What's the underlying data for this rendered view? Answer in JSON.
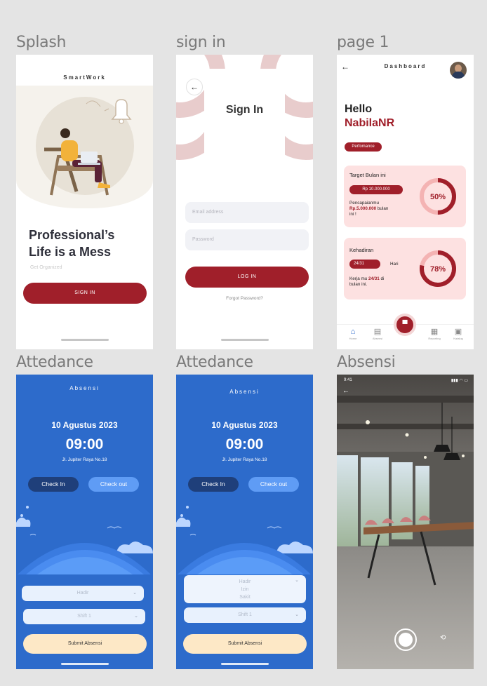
{
  "labels": {
    "splash": "Splash",
    "signin": "sign in",
    "page1": "page 1",
    "attendance1": "Attedance",
    "attendance2": "Attedance",
    "absensi": "Absensi"
  },
  "splash": {
    "brand": "SmartWork",
    "headline_1": "Professional’s",
    "headline_2": "Life is a Mess",
    "subtitle": "Get Organized",
    "button": "SIGN IN"
  },
  "signin": {
    "title": "Sign In",
    "email_placeholder": "Email address",
    "password_placeholder": "Password",
    "button": "LOG IN",
    "forgot": "Forgot Password?"
  },
  "dashboard": {
    "title": "Dashboard",
    "hello": "Hello",
    "name": "NabilaNR",
    "tag": "Perfomance",
    "target": {
      "title": "Target Bulan ini",
      "amount": "Rp 10.000.000",
      "text_1": "Pencapaianmu",
      "highlight": "Rp.5.000.000",
      "text_2": " bulan",
      "text_3": "ini !",
      "percent": "50%",
      "fraction": 0.5
    },
    "attendance": {
      "title": "Kehadiran",
      "count": "24/31",
      "unit": "Hari",
      "text_1": "Kerja mu ",
      "highlight": "24/31",
      "text_2": " di",
      "text_3": "bulan ini.",
      "percent": "78%",
      "fraction": 0.78
    },
    "nav": {
      "home": "Home",
      "absensi": "Absensi",
      "reporting": "Reporting",
      "katalog": "Katalog"
    }
  },
  "attendance": {
    "title": "Absensi",
    "date": "10 Agustus 2023",
    "time": "09:00",
    "address": "Jl. Jupiter Raya No.18",
    "check_in": "Check In",
    "check_out": "Check out",
    "status_value": "Hadir",
    "shift_value": "Shift 1",
    "status_options": [
      "Hadir",
      "Izin",
      "Sakit"
    ],
    "submit": "Submit Absensi"
  },
  "camera": {
    "status_time": "9:41"
  },
  "colors": {
    "brand_red": "#a01f2a",
    "attendance_blue": "#2d6bcb",
    "card_pink": "#fde1e1"
  }
}
